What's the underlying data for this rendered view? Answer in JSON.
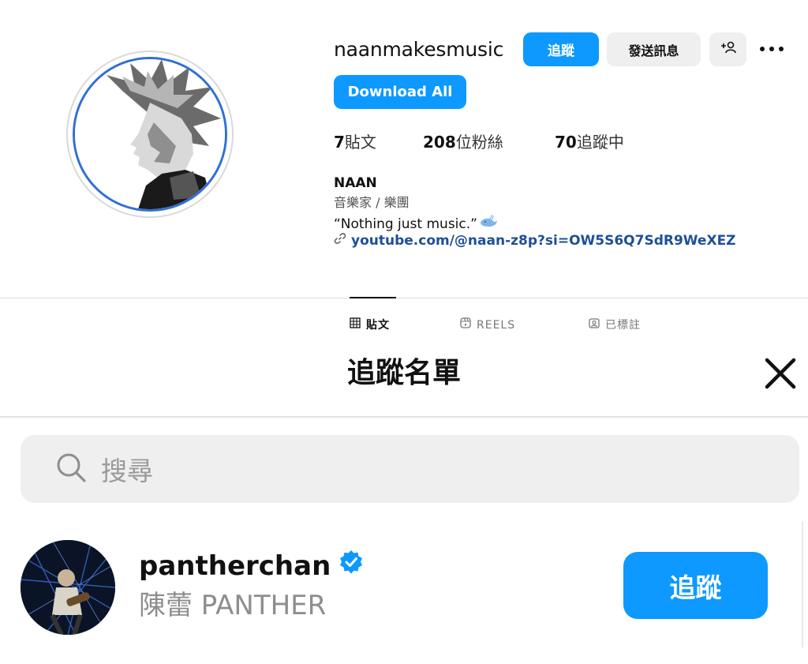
{
  "profile": {
    "username": "naanmakesmusic",
    "follow_label": "追蹤",
    "message_label": "發送訊息",
    "download_label": "Download All",
    "stats": {
      "posts_count": "7",
      "posts_label": "貼文",
      "followers_count": "208",
      "followers_label": "位粉絲",
      "following_count": "70",
      "following_label": "追蹤中"
    },
    "name": "NAAN",
    "category": "音樂家 / 樂團",
    "bio": "“Nothing just music.”",
    "link": "youtube.com/@naan-z8p?si=OW5S6Q7SdR9WeXEZ",
    "tabs": [
      {
        "label": "貼文",
        "icon": "grid-icon",
        "active": true
      },
      {
        "label": "REELS",
        "icon": "reels-icon",
        "active": false
      },
      {
        "label": "已標註",
        "icon": "tagged-icon",
        "active": false
      }
    ]
  },
  "modal": {
    "title": "追蹤名單",
    "search_placeholder": "搜尋",
    "results": [
      {
        "handle": "pantherchan",
        "verified": true,
        "full_name": "陳蕾 PANTHER",
        "follow_label": "追蹤"
      }
    ]
  },
  "colors": {
    "primary": "#0d99ff",
    "secondary_button": "#efefef",
    "link": "#1f4f95",
    "verified": "#0d99ff"
  }
}
